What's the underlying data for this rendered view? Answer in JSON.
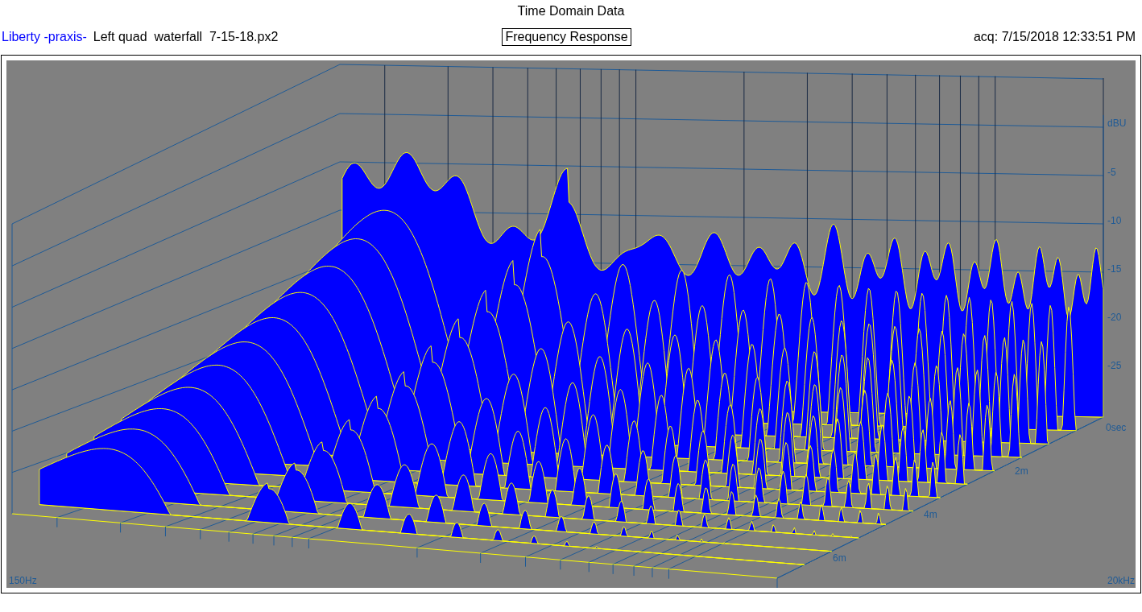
{
  "title": "Time Domain Data",
  "info_bar": {
    "program": "Liberty -praxis-",
    "file": "Left quad  waterfall  7-15-18.px2",
    "mode": "Frequency Response",
    "acquired": "acq: 7/15/2018 12:33:51 PM"
  },
  "plot": {
    "y_unit": "dBU",
    "y_labels": [
      "-5",
      "-10",
      "-15",
      "-20",
      "-25"
    ],
    "time_labels": [
      "0sec",
      "2m",
      "4m",
      "6m"
    ],
    "x_start": "150Hz",
    "x_end": "20kHz"
  }
}
